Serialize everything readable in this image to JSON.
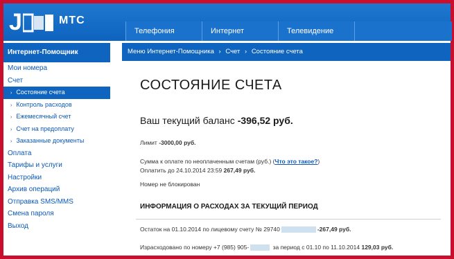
{
  "header": {
    "logo_text": "МТС",
    "nav_tabs": [
      "Телефония",
      "Интернет",
      "Телевидение"
    ]
  },
  "sidebar": {
    "title": "Интернет-Помощник",
    "items": [
      {
        "label": "Мои номера",
        "sub": false,
        "active": false
      },
      {
        "label": "Счет",
        "sub": false,
        "active": false
      },
      {
        "label": "Состояние счета",
        "sub": true,
        "active": true
      },
      {
        "label": "Контроль расходов",
        "sub": true,
        "active": false
      },
      {
        "label": "Ежемесячный счет",
        "sub": true,
        "active": false
      },
      {
        "label": "Счет на предоплату",
        "sub": true,
        "active": false
      },
      {
        "label": "Заказанные документы",
        "sub": true,
        "active": false
      },
      {
        "label": "Оплата",
        "sub": false,
        "active": false
      },
      {
        "label": "Тарифы и услуги",
        "sub": false,
        "active": false
      },
      {
        "label": "Настройки",
        "sub": false,
        "active": false
      },
      {
        "label": "Архив операций",
        "sub": false,
        "active": false
      },
      {
        "label": "Отправка SMS/MMS",
        "sub": false,
        "active": false
      },
      {
        "label": "Смена пароля",
        "sub": false,
        "active": false
      },
      {
        "label": "Выход",
        "sub": false,
        "active": false
      }
    ]
  },
  "breadcrumb": [
    "Меню Интернет-Помощника",
    "Счет",
    "Состояние счета"
  ],
  "breadcrumb_sep": "›",
  "main": {
    "title": "СОСТОЯНИЕ СЧЕТА",
    "balance_label": "Ваш текущий баланс ",
    "balance_value": "-396,52 руб.",
    "limit_label": "Лимит ",
    "limit_value": "-3000,00 руб.",
    "unpaid_label": "Сумма к оплате по неоплаченным счетам (руб.) (",
    "unpaid_link": "Что это такое?",
    "unpaid_close": ")",
    "pay_until_label": "Оплатить до 24.10.2014 23:59 ",
    "pay_until_value": "267,49 руб.",
    "number_status": "Номер не блокирован",
    "section_title": "ИНФОРМАЦИЯ О РАСХОДАХ ЗА ТЕКУЩИЙ ПЕРИОД",
    "remainder_label": "Остаток на 01.10.2014 по лицевому счету № 29740",
    "remainder_value": "-267,49 руб.",
    "spent_label": "Израсходовано по номеру +7 (985) 905-",
    "spent_period": " за период с 01.10 по 11.10.2014 ",
    "spent_value": "129,03 руб."
  },
  "colors": {
    "brand_blue": "#0f64bf",
    "frame_red": "#c8102e",
    "link_blue": "#0b58b8"
  }
}
